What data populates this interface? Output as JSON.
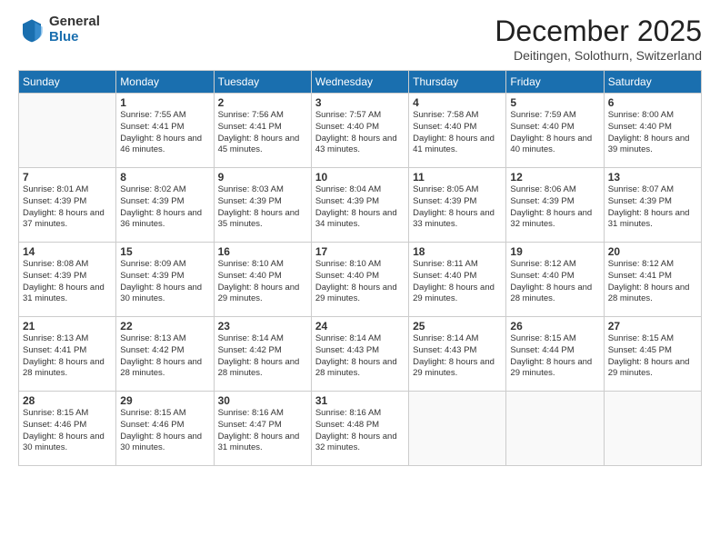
{
  "logo": {
    "general": "General",
    "blue": "Blue"
  },
  "title": "December 2025",
  "location": "Deitingen, Solothurn, Switzerland",
  "days_of_week": [
    "Sunday",
    "Monday",
    "Tuesday",
    "Wednesday",
    "Thursday",
    "Friday",
    "Saturday"
  ],
  "weeks": [
    [
      {
        "day": "",
        "sunrise": "",
        "sunset": "",
        "daylight": ""
      },
      {
        "day": "1",
        "sunrise": "Sunrise: 7:55 AM",
        "sunset": "Sunset: 4:41 PM",
        "daylight": "Daylight: 8 hours and 46 minutes."
      },
      {
        "day": "2",
        "sunrise": "Sunrise: 7:56 AM",
        "sunset": "Sunset: 4:41 PM",
        "daylight": "Daylight: 8 hours and 45 minutes."
      },
      {
        "day": "3",
        "sunrise": "Sunrise: 7:57 AM",
        "sunset": "Sunset: 4:40 PM",
        "daylight": "Daylight: 8 hours and 43 minutes."
      },
      {
        "day": "4",
        "sunrise": "Sunrise: 7:58 AM",
        "sunset": "Sunset: 4:40 PM",
        "daylight": "Daylight: 8 hours and 41 minutes."
      },
      {
        "day": "5",
        "sunrise": "Sunrise: 7:59 AM",
        "sunset": "Sunset: 4:40 PM",
        "daylight": "Daylight: 8 hours and 40 minutes."
      },
      {
        "day": "6",
        "sunrise": "Sunrise: 8:00 AM",
        "sunset": "Sunset: 4:40 PM",
        "daylight": "Daylight: 8 hours and 39 minutes."
      }
    ],
    [
      {
        "day": "7",
        "sunrise": "Sunrise: 8:01 AM",
        "sunset": "Sunset: 4:39 PM",
        "daylight": "Daylight: 8 hours and 37 minutes."
      },
      {
        "day": "8",
        "sunrise": "Sunrise: 8:02 AM",
        "sunset": "Sunset: 4:39 PM",
        "daylight": "Daylight: 8 hours and 36 minutes."
      },
      {
        "day": "9",
        "sunrise": "Sunrise: 8:03 AM",
        "sunset": "Sunset: 4:39 PM",
        "daylight": "Daylight: 8 hours and 35 minutes."
      },
      {
        "day": "10",
        "sunrise": "Sunrise: 8:04 AM",
        "sunset": "Sunset: 4:39 PM",
        "daylight": "Daylight: 8 hours and 34 minutes."
      },
      {
        "day": "11",
        "sunrise": "Sunrise: 8:05 AM",
        "sunset": "Sunset: 4:39 PM",
        "daylight": "Daylight: 8 hours and 33 minutes."
      },
      {
        "day": "12",
        "sunrise": "Sunrise: 8:06 AM",
        "sunset": "Sunset: 4:39 PM",
        "daylight": "Daylight: 8 hours and 32 minutes."
      },
      {
        "day": "13",
        "sunrise": "Sunrise: 8:07 AM",
        "sunset": "Sunset: 4:39 PM",
        "daylight": "Daylight: 8 hours and 31 minutes."
      }
    ],
    [
      {
        "day": "14",
        "sunrise": "Sunrise: 8:08 AM",
        "sunset": "Sunset: 4:39 PM",
        "daylight": "Daylight: 8 hours and 31 minutes."
      },
      {
        "day": "15",
        "sunrise": "Sunrise: 8:09 AM",
        "sunset": "Sunset: 4:39 PM",
        "daylight": "Daylight: 8 hours and 30 minutes."
      },
      {
        "day": "16",
        "sunrise": "Sunrise: 8:10 AM",
        "sunset": "Sunset: 4:40 PM",
        "daylight": "Daylight: 8 hours and 29 minutes."
      },
      {
        "day": "17",
        "sunrise": "Sunrise: 8:10 AM",
        "sunset": "Sunset: 4:40 PM",
        "daylight": "Daylight: 8 hours and 29 minutes."
      },
      {
        "day": "18",
        "sunrise": "Sunrise: 8:11 AM",
        "sunset": "Sunset: 4:40 PM",
        "daylight": "Daylight: 8 hours and 29 minutes."
      },
      {
        "day": "19",
        "sunrise": "Sunrise: 8:12 AM",
        "sunset": "Sunset: 4:40 PM",
        "daylight": "Daylight: 8 hours and 28 minutes."
      },
      {
        "day": "20",
        "sunrise": "Sunrise: 8:12 AM",
        "sunset": "Sunset: 4:41 PM",
        "daylight": "Daylight: 8 hours and 28 minutes."
      }
    ],
    [
      {
        "day": "21",
        "sunrise": "Sunrise: 8:13 AM",
        "sunset": "Sunset: 4:41 PM",
        "daylight": "Daylight: 8 hours and 28 minutes."
      },
      {
        "day": "22",
        "sunrise": "Sunrise: 8:13 AM",
        "sunset": "Sunset: 4:42 PM",
        "daylight": "Daylight: 8 hours and 28 minutes."
      },
      {
        "day": "23",
        "sunrise": "Sunrise: 8:14 AM",
        "sunset": "Sunset: 4:42 PM",
        "daylight": "Daylight: 8 hours and 28 minutes."
      },
      {
        "day": "24",
        "sunrise": "Sunrise: 8:14 AM",
        "sunset": "Sunset: 4:43 PM",
        "daylight": "Daylight: 8 hours and 28 minutes."
      },
      {
        "day": "25",
        "sunrise": "Sunrise: 8:14 AM",
        "sunset": "Sunset: 4:43 PM",
        "daylight": "Daylight: 8 hours and 29 minutes."
      },
      {
        "day": "26",
        "sunrise": "Sunrise: 8:15 AM",
        "sunset": "Sunset: 4:44 PM",
        "daylight": "Daylight: 8 hours and 29 minutes."
      },
      {
        "day": "27",
        "sunrise": "Sunrise: 8:15 AM",
        "sunset": "Sunset: 4:45 PM",
        "daylight": "Daylight: 8 hours and 29 minutes."
      }
    ],
    [
      {
        "day": "28",
        "sunrise": "Sunrise: 8:15 AM",
        "sunset": "Sunset: 4:46 PM",
        "daylight": "Daylight: 8 hours and 30 minutes."
      },
      {
        "day": "29",
        "sunrise": "Sunrise: 8:15 AM",
        "sunset": "Sunset: 4:46 PM",
        "daylight": "Daylight: 8 hours and 30 minutes."
      },
      {
        "day": "30",
        "sunrise": "Sunrise: 8:16 AM",
        "sunset": "Sunset: 4:47 PM",
        "daylight": "Daylight: 8 hours and 31 minutes."
      },
      {
        "day": "31",
        "sunrise": "Sunrise: 8:16 AM",
        "sunset": "Sunset: 4:48 PM",
        "daylight": "Daylight: 8 hours and 32 minutes."
      },
      {
        "day": "",
        "sunrise": "",
        "sunset": "",
        "daylight": ""
      },
      {
        "day": "",
        "sunrise": "",
        "sunset": "",
        "daylight": ""
      },
      {
        "day": "",
        "sunrise": "",
        "sunset": "",
        "daylight": ""
      }
    ]
  ]
}
